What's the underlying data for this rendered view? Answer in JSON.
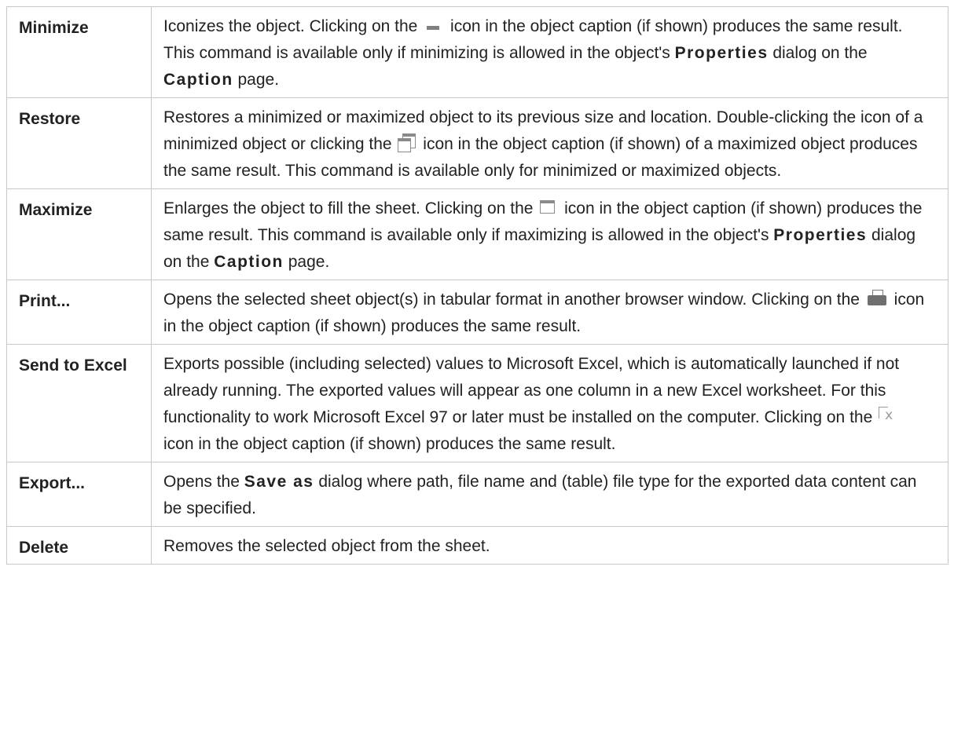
{
  "rows": [
    {
      "term": "Minimize",
      "desc": {
        "t1": "Iconizes the object. Clicking on the ",
        "t2": " icon in the object caption (if shown) produces the same result. This command is available only if minimizing is allowed in the object's ",
        "b1": "Properties",
        "t3": " dialog on the ",
        "b2": "Caption",
        "t4": " page."
      },
      "icon": "minimize-icon"
    },
    {
      "term": "Restore",
      "desc": {
        "t1": "Restores a minimized or maximized object to its previous size and location. Double-clicking the icon of a minimized object or clicking the ",
        "t2": " icon in the object caption (if shown) of a maximized object produces the same result. This command is available only for minimized or maximized objects."
      },
      "icon": "restore-icon"
    },
    {
      "term": "Maximize",
      "desc": {
        "t1": "Enlarges the object to fill the sheet. Clicking on the ",
        "t2": " icon in the object caption (if shown) produces the same result. This command is available only if maximizing is allowed in the object's ",
        "b1": "Properties",
        "t3": " dialog on the ",
        "b2": "Caption",
        "t4": " page."
      },
      "icon": "maximize-icon"
    },
    {
      "term": "Print...",
      "desc": {
        "t1": "Opens the selected sheet object(s) in tabular format in another browser window. Clicking on the ",
        "t2": " icon in the object caption (if shown) produces the same result."
      },
      "icon": "print-icon"
    },
    {
      "term": "Send to Excel",
      "desc": {
        "t1": "Exports possible (including selected) values to Microsoft Excel, which is automatically launched if not already running. The exported values will appear as one column in a new Excel worksheet. For this functionality to work Microsoft Excel 97 or later must be installed on the computer. Clicking on the ",
        "t2": " icon in the object caption (if shown) produces the same result."
      },
      "icon": "send-to-excel-icon"
    },
    {
      "term": "Export...",
      "desc": {
        "t1": "Opens the ",
        "b1": "Save as",
        "t2": " dialog where path, file name and (table) file type for the exported data content can be specified."
      }
    },
    {
      "term": "Delete",
      "desc": {
        "t1": "Removes the selected object from the sheet."
      }
    }
  ]
}
